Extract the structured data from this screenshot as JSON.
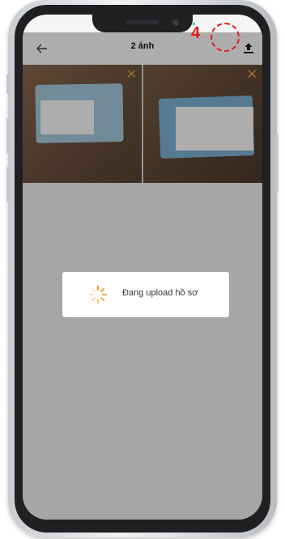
{
  "header": {
    "title": "2 ảnh",
    "back_icon": "arrow-left-icon",
    "upload_icon": "upload-icon"
  },
  "annotation": {
    "step_number": "4",
    "color": "#e61a1a"
  },
  "photos": [
    {
      "remove_icon": "close-icon"
    },
    {
      "remove_icon": "close-icon"
    }
  ],
  "dialog": {
    "message": "Đang upload hồ sơ",
    "spinner_color": "#f0a030"
  }
}
